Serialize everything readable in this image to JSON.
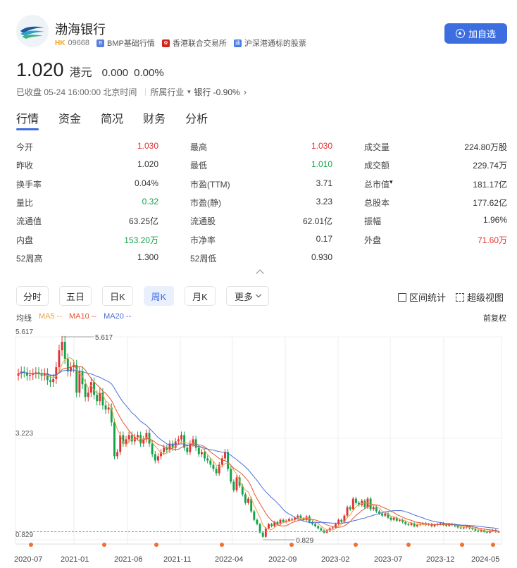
{
  "header": {
    "name": "渤海银行",
    "market": "HK",
    "code": "09668",
    "tag1": "BMP基础行情",
    "tag2": "香港联合交易所",
    "tag3": "沪深港通标的股票",
    "add_label": "加自选"
  },
  "price": {
    "last": "1.020",
    "currency": "港元",
    "change": "0.000",
    "change_pct": "0.00%"
  },
  "status": {
    "text": "已收盘 05-24 16:00:00 北京时间",
    "industry_label": "所属行业",
    "industry": "银行 -0.90%"
  },
  "tabs": [
    "行情",
    "资金",
    "简况",
    "财务",
    "分析"
  ],
  "quote": {
    "col1": [
      {
        "label": "今开",
        "value": "1.030",
        "color": "red"
      },
      {
        "label": "昨收",
        "value": "1.020",
        "color": ""
      },
      {
        "label": "换手率",
        "value": "0.04%",
        "color": ""
      },
      {
        "label": "量比",
        "value": "0.32",
        "color": "green"
      },
      {
        "label": "流通值",
        "value": "63.25亿",
        "color": ""
      },
      {
        "label": "内盘",
        "value": "153.20万",
        "color": "green"
      },
      {
        "label": "52周高",
        "value": "1.300",
        "color": ""
      }
    ],
    "col2": [
      {
        "label": "最高",
        "value": "1.030",
        "color": "red"
      },
      {
        "label": "最低",
        "value": "1.010",
        "color": "green"
      },
      {
        "label": "市盈(TTM)",
        "value": "3.71",
        "color": ""
      },
      {
        "label": "市盈(静)",
        "value": "3.23",
        "color": ""
      },
      {
        "label": "流通股",
        "value": "62.01亿",
        "color": ""
      },
      {
        "label": "市净率",
        "value": "0.17",
        "color": ""
      },
      {
        "label": "52周低",
        "value": "0.930",
        "color": ""
      }
    ],
    "col3": [
      {
        "label": "成交量",
        "value": "224.80万股",
        "color": ""
      },
      {
        "label": "成交额",
        "value": "229.74万",
        "color": ""
      },
      {
        "label": "总市值",
        "value": "181.17亿",
        "color": ""
      },
      {
        "label": "总股本",
        "value": "177.62亿",
        "color": ""
      },
      {
        "label": "振幅",
        "value": "1.96%",
        "color": ""
      },
      {
        "label": "外盘",
        "value": "71.60万",
        "color": "red"
      }
    ]
  },
  "periods": [
    "分时",
    "五日",
    "日K",
    "周K",
    "月K",
    "更多"
  ],
  "active_period": "周K",
  "tools": {
    "range": "区间统计",
    "super": "超级视图"
  },
  "ma": {
    "label": "均线",
    "ma5": "MA5 --",
    "ma10": "MA10 --",
    "ma20": "MA20 --"
  },
  "fq": "前复权",
  "colors": {
    "up": "#e03333",
    "down": "#13a34a",
    "accent": "#3d6ee0",
    "ma5": "#f0a040",
    "ma10": "#e05533",
    "ma20": "#4b6fd8"
  },
  "chart_data": {
    "type": "candlestick",
    "x_ticks": [
      "2020-07",
      "2021-01",
      "2021-06",
      "2021-11",
      "2022-04",
      "2022-09",
      "2023-02",
      "2023-07",
      "2023-12",
      "2024-05"
    ],
    "y_ticks": [
      "5.617",
      "3.223",
      "0.829"
    ],
    "ylim": [
      0.829,
      5.617
    ],
    "max_label": "5.617",
    "min_label": "0.829",
    "closes": [
      4.75,
      4.8,
      4.78,
      4.7,
      4.72,
      4.75,
      4.78,
      4.74,
      4.7,
      4.76,
      4.6,
      4.55,
      4.62,
      4.9,
      5.3,
      5.5,
      5.1,
      4.8,
      4.9,
      4.95,
      4.3,
      4.8,
      4.5,
      4.2,
      4.3,
      4.55,
      4.25,
      4.1,
      4.3,
      4.0,
      3.9,
      3.95,
      3.6,
      2.8,
      2.9,
      3.3,
      3.1,
      3.2,
      3.3,
      3.15,
      3.25,
      3.3,
      3.1,
      3.2,
      3.35,
      3.1,
      2.85,
      2.7,
      2.8,
      2.9,
      3.0,
      2.95,
      3.1,
      3.0,
      3.15,
      3.2,
      3.3,
      3.0,
      2.9,
      3.1,
      3.2,
      3.0,
      2.85,
      2.9,
      2.75,
      2.7,
      2.6,
      2.5,
      2.4,
      2.6,
      2.75,
      2.9,
      2.5,
      2.2,
      2.0,
      2.3,
      2.1,
      1.9,
      1.7,
      1.8,
      1.5,
      1.3,
      1.2,
      1.0,
      0.9,
      1.1,
      1.2,
      1.15,
      1.25,
      1.2,
      1.3,
      1.25,
      1.28,
      1.32,
      1.3,
      1.35,
      1.4,
      1.33,
      1.3,
      1.38,
      1.25,
      1.2,
      1.15,
      1.1,
      1.05,
      1.0,
      1.05,
      1.1,
      1.12,
      1.2,
      1.3,
      1.25,
      1.4,
      1.6,
      1.55,
      1.8,
      1.7,
      1.65,
      1.75,
      1.6,
      1.8,
      1.55,
      1.6,
      1.5,
      1.45,
      1.4,
      1.45,
      1.35,
      1.3,
      1.35,
      1.28,
      1.3,
      1.25,
      1.2,
      1.18,
      1.22,
      1.15,
      1.18,
      1.2,
      1.22,
      1.18,
      1.2,
      1.15,
      1.18,
      1.2,
      1.22,
      1.18,
      1.16,
      1.2,
      1.18,
      1.15,
      1.12,
      1.1,
      1.12,
      1.15,
      1.1,
      1.08,
      1.05,
      1.03,
      1.06,
      1.02,
      1.0,
      1.04,
      1.06,
      1.02,
      1.02
    ]
  }
}
